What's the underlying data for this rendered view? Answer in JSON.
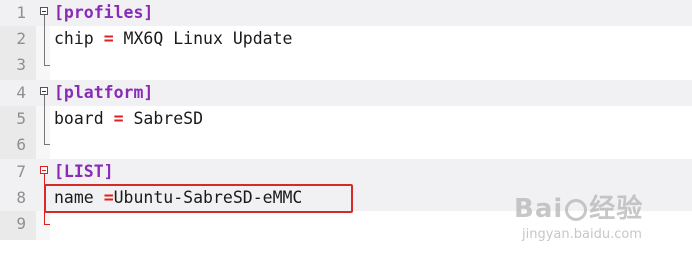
{
  "editor": {
    "lines": [
      {
        "number": "1",
        "section": "[profiles]"
      },
      {
        "number": "2",
        "key": "chip",
        "op": "=",
        "value": " MX6Q Linux Update"
      },
      {
        "number": "3"
      },
      {
        "number": "4",
        "section": "[platform]"
      },
      {
        "number": "5",
        "key": "board",
        "op": "=",
        "value": " SabreSD"
      },
      {
        "number": "6"
      },
      {
        "number": "7",
        "section": "[LIST]"
      },
      {
        "number": "8",
        "key": "name",
        "op": "=",
        "value": "Ubuntu-SabreSD-eMMC"
      },
      {
        "number": "9"
      }
    ]
  },
  "watermark": {
    "logo_left": "Bai",
    "logo_right": "经验",
    "url": "jingyan.baidu.com"
  },
  "colors": {
    "section": "#8a2bb8",
    "operator": "#e02020",
    "highlight_border": "#d42a2a"
  }
}
